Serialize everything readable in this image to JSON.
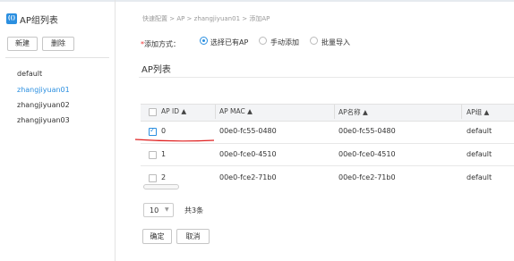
{
  "left_panel": {
    "title": "AP组列表",
    "logo_text": "(()",
    "new_button": "新建",
    "delete_button": "删除",
    "groups": [
      "default",
      "zhangjiyuan01",
      "zhangjiyuan02",
      "zhangjiyuan03"
    ],
    "active_group": "zhangjiyuan01"
  },
  "breadcrumb": "快速配置 > AP > zhangjiyuan01 > 添加AP",
  "add_mode": {
    "required_mark": "*",
    "label": "添加方式：",
    "options": [
      "选择已有AP",
      "手动添加",
      "批量导入"
    ],
    "selected": "选择已有AP"
  },
  "section_title": "AP列表",
  "table": {
    "columns": [
      "AP ID ▲",
      "AP MAC ▲",
      "AP名称 ▲",
      "AP组 ▲"
    ],
    "rows": [
      {
        "id": "0",
        "mac": "00e0-fc55-0480",
        "name": "00e0-fc55-0480",
        "group": "default",
        "checked": true
      },
      {
        "id": "1",
        "mac": "00e0-fce0-4510",
        "name": "00e0-fce0-4510",
        "group": "default",
        "checked": false
      },
      {
        "id": "2",
        "mac": "00e0-fce2-71b0",
        "name": "00e0-fce2-71b0",
        "group": "default",
        "checked": false
      }
    ]
  },
  "pagination": {
    "page_size": "10",
    "caret": "▼",
    "total": "共3条"
  },
  "actions": {
    "ok": "确定",
    "cancel": "取消"
  },
  "colors": {
    "accent": "#2b8fe0",
    "annotation": "#e02020"
  }
}
